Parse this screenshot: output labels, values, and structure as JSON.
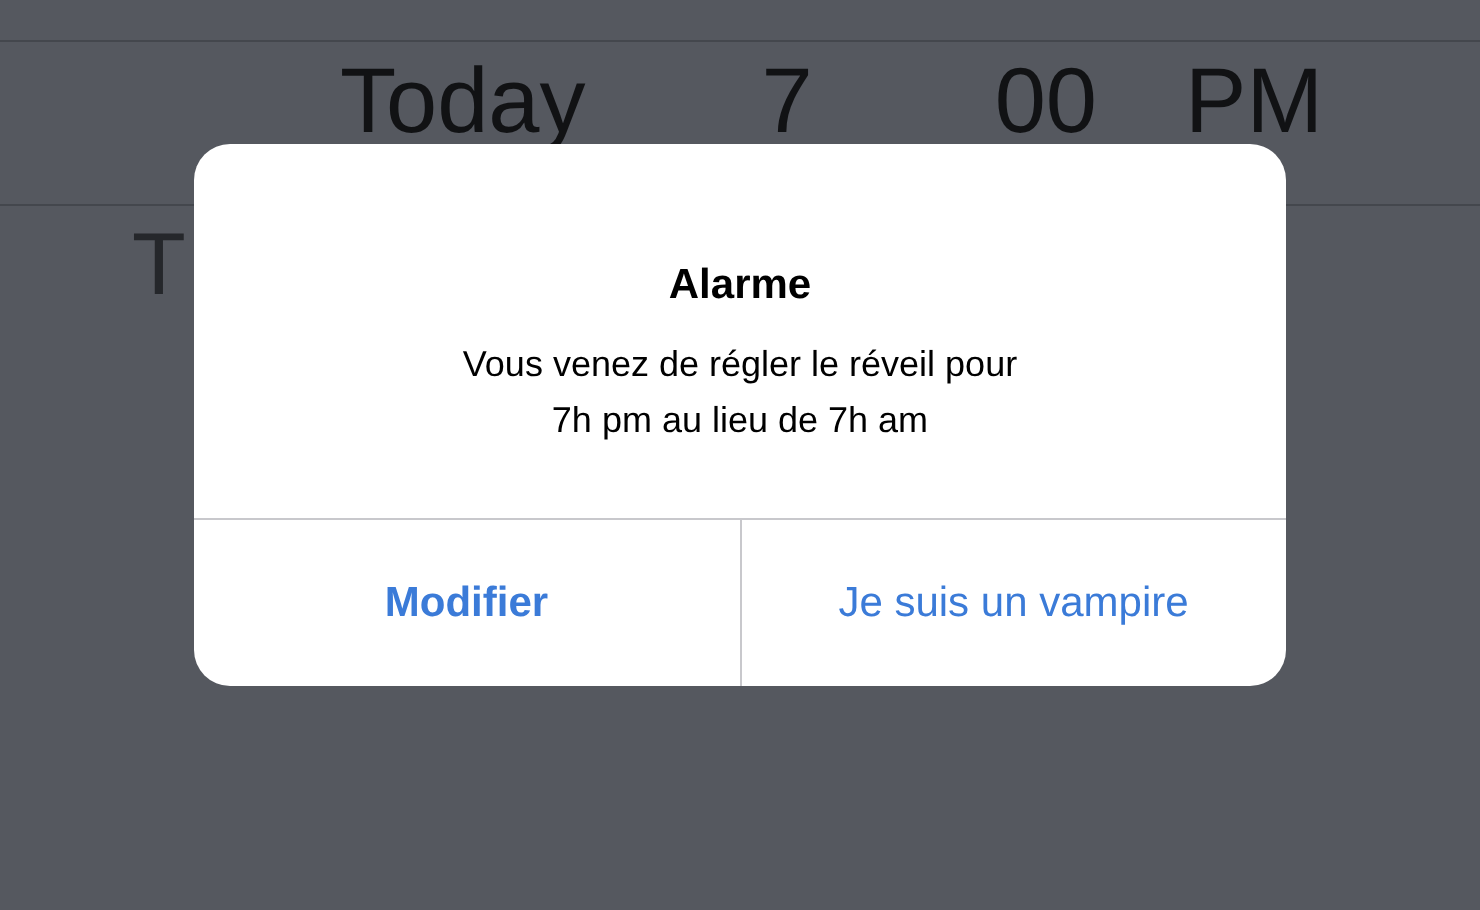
{
  "picker": {
    "selected_row": [
      "Today",
      "7",
      "00",
      "PM"
    ],
    "next_row": [
      "T"
    ]
  },
  "alert": {
    "title": "Alarme",
    "message": [
      "Vous venez de régler le réveil pour",
      "7h pm au lieu de 7h am"
    ],
    "buttons": [
      {
        "label": "Modifier",
        "kind": "preferred"
      },
      {
        "label": "Je suis un vampire",
        "kind": "default"
      }
    ]
  }
}
